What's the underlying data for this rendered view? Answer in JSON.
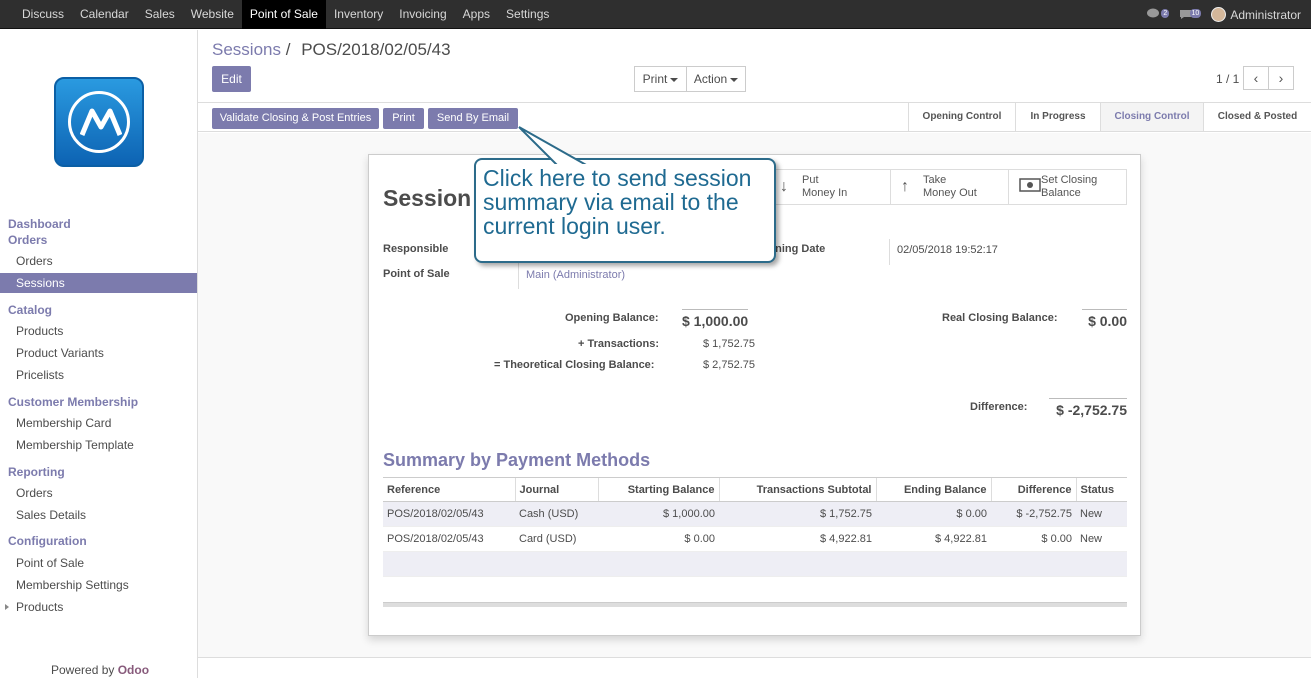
{
  "topbar": {
    "menu": [
      "Discuss",
      "Calendar",
      "Sales",
      "Website",
      "Point of Sale",
      "Inventory",
      "Invoicing",
      "Apps",
      "Settings"
    ],
    "active_index": 4,
    "chat_badge": "2",
    "messages_badge": "10",
    "user": "Administrator"
  },
  "sidebar": {
    "dashboard": "Dashboard",
    "orders_section": "Orders",
    "orders_items": [
      "Orders",
      "Sessions"
    ],
    "catalog_section": "Catalog",
    "catalog_items": [
      "Products",
      "Product Variants",
      "Pricelists"
    ],
    "membership_section": "Customer Membership",
    "membership_items": [
      "Membership Card",
      "Membership Template"
    ],
    "reporting_section": "Reporting",
    "reporting_items": [
      "Orders",
      "Sales Details"
    ],
    "config_section": "Configuration",
    "config_items": [
      "Point of Sale",
      "Membership Settings",
      "Products"
    ],
    "powered_by": "Powered by",
    "powered_brand": "Odoo"
  },
  "breadcrumb": {
    "parent": "Sessions",
    "sep": "/",
    "current": "POS/2018/02/05/43"
  },
  "buttons": {
    "edit": "Edit",
    "print": "Print",
    "action": "Action"
  },
  "pager": {
    "text": "1 / 1",
    "prev": "‹",
    "next": "›"
  },
  "statusbar": {
    "actions": [
      "Validate Closing & Post Entries",
      "Print",
      "Send By Email"
    ],
    "stages": [
      "Opening Control",
      "In Progress",
      "Closing Control",
      "Closed & Posted"
    ],
    "current_stage": "Closing Control"
  },
  "form": {
    "title": "Session",
    "smart_buttons": [
      {
        "icon": "arrow-down-icon",
        "glyph": "↓",
        "label1": "Put",
        "label2": "Money In"
      },
      {
        "icon": "arrow-up-icon",
        "glyph": "↑",
        "label1": "Take",
        "label2": "Money Out"
      },
      {
        "icon": "money-icon",
        "glyph": "▭",
        "label1": "Set Closing",
        "label2": "Balance"
      }
    ],
    "responsible_label": "Responsible",
    "pos_label": "Point of Sale",
    "pos_value": "Main (Administrator)",
    "opening_date_label": "ening Date",
    "opening_date_value": "02/05/2018 19:52:17",
    "opening_balance_label": "Opening Balance:",
    "opening_balance": "$ 1,000.00",
    "transactions_label": "+ Transactions:",
    "transactions": "$ 1,752.75",
    "theoretical_label": "= Theoretical Closing Balance:",
    "theoretical": "$ 2,752.75",
    "real_closing_label": "Real Closing Balance:",
    "real_closing": "$ 0.00",
    "difference_label": "Difference:",
    "difference": "$ -2,752.75"
  },
  "summary": {
    "title": "Summary by Payment Methods",
    "columns": [
      "Reference",
      "Journal",
      "Starting Balance",
      "Transactions Subtotal",
      "Ending Balance",
      "Difference",
      "Status"
    ],
    "rows": [
      [
        "POS/2018/02/05/43",
        "Cash (USD)",
        "$ 1,000.00",
        "$ 1,752.75",
        "$ 0.00",
        "$ -2,752.75",
        "New"
      ],
      [
        "POS/2018/02/05/43",
        "Card (USD)",
        "$ 0.00",
        "$ 4,922.81",
        "$ 4,922.81",
        "$ 0.00",
        "New"
      ]
    ]
  },
  "callout": {
    "text": "Click here to send session summary via email to the current login user."
  },
  "colors": {
    "accent": "#7c7bad",
    "topbar": "#2f2f2f",
    "callout_text": "#1f6a91",
    "callout_border": "#2c6b8a"
  }
}
